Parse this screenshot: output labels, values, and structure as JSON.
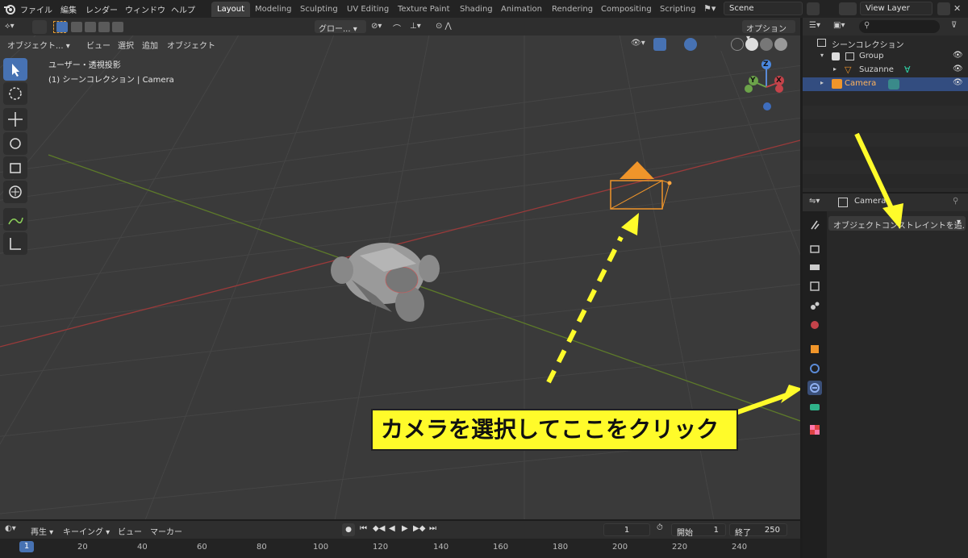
{
  "menu": {
    "file": "ファイル",
    "edit": "編集",
    "render": "レンダー",
    "window": "ウィンドウ",
    "help": "ヘルプ"
  },
  "workspaces": [
    "Layout",
    "Modeling",
    "Sculpting",
    "UV Editing",
    "Texture Paint",
    "Shading",
    "Animation",
    "Rendering",
    "Compositing",
    "Scripting"
  ],
  "scene": {
    "name": "Scene",
    "view_layer": "View Layer"
  },
  "viewport_header": {
    "mode": "オブジェクト...",
    "view": "ビュー",
    "select": "選択",
    "add": "追加",
    "object": "オブジェクト",
    "transform": "グロー...",
    "options": "オプション"
  },
  "viewport_overlay": {
    "view_name": "ユーザー・透視投影",
    "collection_info": "(1) シーンコレクション | Camera"
  },
  "gizmo": {
    "z": "Z",
    "y": "Y",
    "x": "X"
  },
  "outliner": {
    "scene_collection": "シーンコレクション",
    "items": [
      {
        "label": "Group",
        "icon": "collection-icon"
      },
      {
        "label": "Suzanne",
        "icon": "mesh-icon"
      },
      {
        "label": "Camera",
        "icon": "camera-icon",
        "selected": true
      }
    ]
  },
  "properties": {
    "object_name": "Camera",
    "add_constraint": "オブジェクトコンストレイントを追..."
  },
  "timeline": {
    "playback": "再生",
    "keying": "キーイング",
    "view": "ビュー",
    "marker": "マーカー",
    "current_frame": "1",
    "start_label": "開始",
    "start": "1",
    "end_label": "終了",
    "end": "250",
    "ticks": [
      "1",
      "20",
      "40",
      "60",
      "80",
      "100",
      "120",
      "140",
      "160",
      "180",
      "200",
      "220",
      "240"
    ]
  },
  "annotation": {
    "text": "カメラを選択してここをクリック"
  },
  "colors": {
    "accent": "#4772b3",
    "annotation_yellow": "#fffb2a",
    "camera_orange": "#f0952a"
  }
}
